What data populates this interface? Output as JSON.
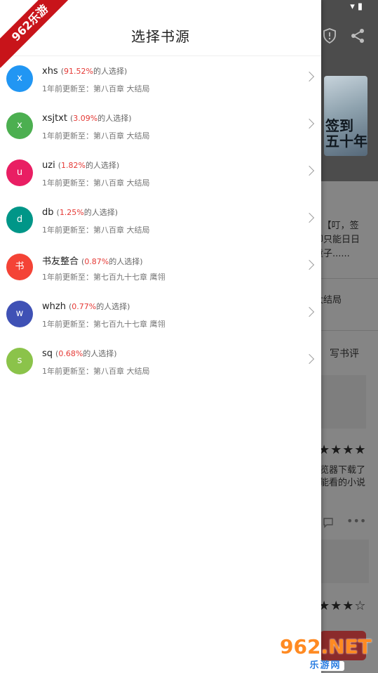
{
  "drawer": {
    "title": "选择书源",
    "sources": [
      {
        "initial": "x",
        "name": "xhs",
        "pct": "91.52%",
        "pct_suffix": "的人选择)",
        "update": "1年前更新至：第八百章 大结局",
        "color": "#2196F3"
      },
      {
        "initial": "x",
        "name": "xsjtxt",
        "pct": "3.09%",
        "pct_suffix": "的人选择)",
        "update": "1年前更新至：第八百章 大结局",
        "color": "#4CAF50"
      },
      {
        "initial": "u",
        "name": "uzi",
        "pct": "1.82%",
        "pct_suffix": "的人选择)",
        "update": "1年前更新至：第八百章 大结局",
        "color": "#E91E63"
      },
      {
        "initial": "d",
        "name": "db",
        "pct": "1.25%",
        "pct_suffix": "的人选择)",
        "update": "1年前更新至：第八百章 大结局",
        "color": "#009688"
      },
      {
        "initial": "书",
        "name": "书友整合",
        "pct": "0.87%",
        "pct_suffix": "的人选择)",
        "update": "1年前更新至：第七百九十七章 鹰翎",
        "color": "#F44336"
      },
      {
        "initial": "w",
        "name": "whzh",
        "pct": "0.77%",
        "pct_suffix": "的人选择)",
        "update": "1年前更新至：第七百九十七章 鹰翎",
        "color": "#3F51B5"
      },
      {
        "initial": "s",
        "name": "sq",
        "pct": "0.68%",
        "pct_suffix": "的人选择)",
        "update": "1年前更新至：第八百章 大结局",
        "color": "#8BC34A"
      }
    ]
  },
  "background": {
    "status_icons": "▾ ▮",
    "cover_text": "签到\n五十年",
    "intro_lines": [
      "]】【叮，签",
      "却只能日日",
      "童子......"
    ],
    "latest": "大结局",
    "write_review": "写书评",
    "review_text": [
      "览器下载了",
      "能看的小说"
    ],
    "stars_full": "★★★★",
    "stars_mixed": "★★★☆"
  },
  "watermark": {
    "ribbon": "962乐游",
    "logo_top": "962.NET",
    "logo_bottom": "乐游网"
  }
}
